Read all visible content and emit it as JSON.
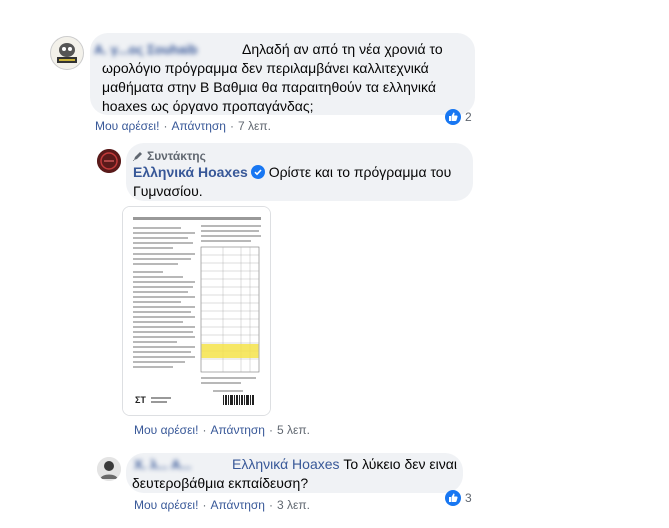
{
  "comment1": {
    "author_name_blurred": "Α. γ...ος Σouhaib",
    "text": "Δηλαδή αν από τη νέα χρονιά το ωρολόγιο πρόγραμμα δεν περιλαμβάνει καλλιτεχνικά μαθήματα στην Β Βαθμια θα παραιτηθούν τα ελληνικά hoaxes ως όργανο προπαγάνδας;",
    "like_label": "Μου αρέσει!",
    "reply_label": "Απάντηση",
    "time": "7 λεπ.",
    "reaction_count": "2"
  },
  "comment2": {
    "author_tag": "Συντάκτης",
    "author_name": "Ελληνικά Hoaxes",
    "text": "Ορίστε και το πρόγραμμα του Γυμνασίου.",
    "like_label": "Μου αρέσει!",
    "reply_label": "Απάντηση",
    "time": "5 λεπ."
  },
  "comment3": {
    "author_name_blurred": "Χ. λ... Α...",
    "mention": "Ελληνικά Hoaxes",
    "text": "Το λύκειο δεν ειναι δευτεροβάθμια εκπαίδευση?",
    "like_label": "Μου αρέσει!",
    "reply_label": "Απάντηση",
    "time": "3 λεπ.",
    "reaction_count": "3"
  },
  "colors": {
    "link": "#385898",
    "bubble": "#f0f2f5",
    "like_blue": "#1877f2",
    "highlight": "#f5e34a"
  }
}
